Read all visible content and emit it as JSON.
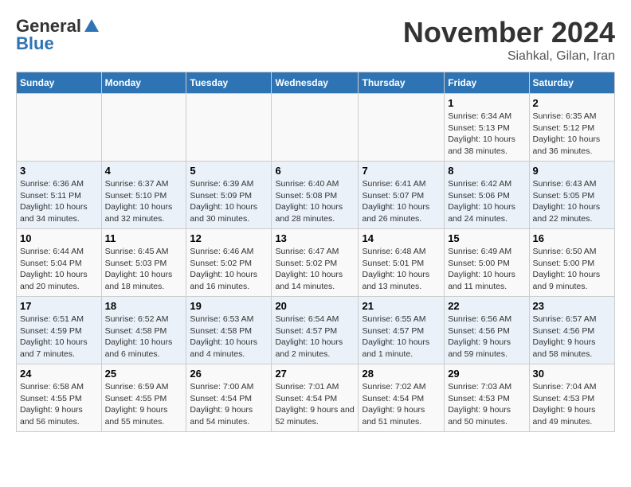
{
  "logo": {
    "general": "General",
    "blue": "Blue"
  },
  "title": "November 2024",
  "location": "Siahkal, Gilan, Iran",
  "days_of_week": [
    "Sunday",
    "Monday",
    "Tuesday",
    "Wednesday",
    "Thursday",
    "Friday",
    "Saturday"
  ],
  "weeks": [
    [
      {
        "day": "",
        "info": ""
      },
      {
        "day": "",
        "info": ""
      },
      {
        "day": "",
        "info": ""
      },
      {
        "day": "",
        "info": ""
      },
      {
        "day": "",
        "info": ""
      },
      {
        "day": "1",
        "info": "Sunrise: 6:34 AM\nSunset: 5:13 PM\nDaylight: 10 hours and 38 minutes."
      },
      {
        "day": "2",
        "info": "Sunrise: 6:35 AM\nSunset: 5:12 PM\nDaylight: 10 hours and 36 minutes."
      }
    ],
    [
      {
        "day": "3",
        "info": "Sunrise: 6:36 AM\nSunset: 5:11 PM\nDaylight: 10 hours and 34 minutes."
      },
      {
        "day": "4",
        "info": "Sunrise: 6:37 AM\nSunset: 5:10 PM\nDaylight: 10 hours and 32 minutes."
      },
      {
        "day": "5",
        "info": "Sunrise: 6:39 AM\nSunset: 5:09 PM\nDaylight: 10 hours and 30 minutes."
      },
      {
        "day": "6",
        "info": "Sunrise: 6:40 AM\nSunset: 5:08 PM\nDaylight: 10 hours and 28 minutes."
      },
      {
        "day": "7",
        "info": "Sunrise: 6:41 AM\nSunset: 5:07 PM\nDaylight: 10 hours and 26 minutes."
      },
      {
        "day": "8",
        "info": "Sunrise: 6:42 AM\nSunset: 5:06 PM\nDaylight: 10 hours and 24 minutes."
      },
      {
        "day": "9",
        "info": "Sunrise: 6:43 AM\nSunset: 5:05 PM\nDaylight: 10 hours and 22 minutes."
      }
    ],
    [
      {
        "day": "10",
        "info": "Sunrise: 6:44 AM\nSunset: 5:04 PM\nDaylight: 10 hours and 20 minutes."
      },
      {
        "day": "11",
        "info": "Sunrise: 6:45 AM\nSunset: 5:03 PM\nDaylight: 10 hours and 18 minutes."
      },
      {
        "day": "12",
        "info": "Sunrise: 6:46 AM\nSunset: 5:02 PM\nDaylight: 10 hours and 16 minutes."
      },
      {
        "day": "13",
        "info": "Sunrise: 6:47 AM\nSunset: 5:02 PM\nDaylight: 10 hours and 14 minutes."
      },
      {
        "day": "14",
        "info": "Sunrise: 6:48 AM\nSunset: 5:01 PM\nDaylight: 10 hours and 13 minutes."
      },
      {
        "day": "15",
        "info": "Sunrise: 6:49 AM\nSunset: 5:00 PM\nDaylight: 10 hours and 11 minutes."
      },
      {
        "day": "16",
        "info": "Sunrise: 6:50 AM\nSunset: 5:00 PM\nDaylight: 10 hours and 9 minutes."
      }
    ],
    [
      {
        "day": "17",
        "info": "Sunrise: 6:51 AM\nSunset: 4:59 PM\nDaylight: 10 hours and 7 minutes."
      },
      {
        "day": "18",
        "info": "Sunrise: 6:52 AM\nSunset: 4:58 PM\nDaylight: 10 hours and 6 minutes."
      },
      {
        "day": "19",
        "info": "Sunrise: 6:53 AM\nSunset: 4:58 PM\nDaylight: 10 hours and 4 minutes."
      },
      {
        "day": "20",
        "info": "Sunrise: 6:54 AM\nSunset: 4:57 PM\nDaylight: 10 hours and 2 minutes."
      },
      {
        "day": "21",
        "info": "Sunrise: 6:55 AM\nSunset: 4:57 PM\nDaylight: 10 hours and 1 minute."
      },
      {
        "day": "22",
        "info": "Sunrise: 6:56 AM\nSunset: 4:56 PM\nDaylight: 9 hours and 59 minutes."
      },
      {
        "day": "23",
        "info": "Sunrise: 6:57 AM\nSunset: 4:56 PM\nDaylight: 9 hours and 58 minutes."
      }
    ],
    [
      {
        "day": "24",
        "info": "Sunrise: 6:58 AM\nSunset: 4:55 PM\nDaylight: 9 hours and 56 minutes."
      },
      {
        "day": "25",
        "info": "Sunrise: 6:59 AM\nSunset: 4:55 PM\nDaylight: 9 hours and 55 minutes."
      },
      {
        "day": "26",
        "info": "Sunrise: 7:00 AM\nSunset: 4:54 PM\nDaylight: 9 hours and 54 minutes."
      },
      {
        "day": "27",
        "info": "Sunrise: 7:01 AM\nSunset: 4:54 PM\nDaylight: 9 hours and 52 minutes."
      },
      {
        "day": "28",
        "info": "Sunrise: 7:02 AM\nSunset: 4:54 PM\nDaylight: 9 hours and 51 minutes."
      },
      {
        "day": "29",
        "info": "Sunrise: 7:03 AM\nSunset: 4:53 PM\nDaylight: 9 hours and 50 minutes."
      },
      {
        "day": "30",
        "info": "Sunrise: 7:04 AM\nSunset: 4:53 PM\nDaylight: 9 hours and 49 minutes."
      }
    ]
  ]
}
